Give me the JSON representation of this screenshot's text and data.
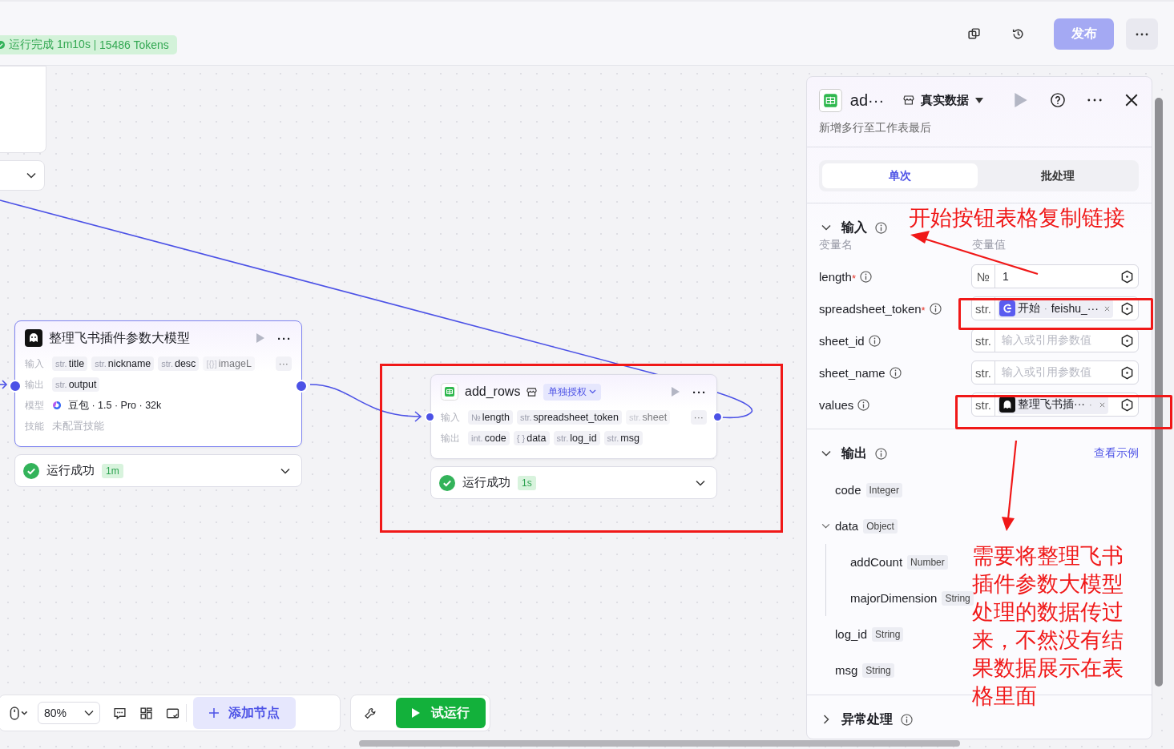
{
  "header": {
    "run_status": "运行完成 1m10s",
    "tokens": "15486 Tokens",
    "publish_button": "发布",
    "publish_disabled": true
  },
  "nodes": [
    {
      "kind": "model",
      "title": "整理飞书插件参数大模型",
      "selected": true,
      "more": "···",
      "rows": [
        {
          "label": "输入",
          "overflow": "···",
          "params": [
            {
              "type": "str.",
              "name": "title",
              "faded": false
            },
            {
              "type": "str.",
              "name": "nickname",
              "faded": false
            },
            {
              "type": "str.",
              "name": "desc",
              "faded": false
            },
            {
              "type": "[{}]",
              "name": "imageL",
              "faded": true
            }
          ]
        },
        {
          "label": "输出",
          "params": [
            {
              "type": "str.",
              "name": "output",
              "faded": false
            }
          ]
        }
      ],
      "info": [
        {
          "label": "模型",
          "value": "豆包 · 1.5 · Pro · 32k",
          "kind": "model"
        },
        {
          "label": "技能",
          "value": "未配置技能",
          "kind": "empty"
        }
      ],
      "status": "运行成功",
      "duration": "1m"
    },
    {
      "kind": "sheet",
      "title": "add_rows",
      "auth_tag": "单独授权",
      "selected": false,
      "more": "···",
      "rows": [
        {
          "label": "输入",
          "overflow": "···",
          "params": [
            {
              "type": "№",
              "name": "length",
              "faded": false
            },
            {
              "type": "str.",
              "name": "spreadsheet_token",
              "faded": false
            },
            {
              "type": "str.",
              "name": "sheet",
              "faded": true
            }
          ]
        },
        {
          "label": "输出",
          "params": [
            {
              "type": "int.",
              "name": "code",
              "faded": false
            },
            {
              "type": "{ }",
              "name": "data",
              "faded": false
            },
            {
              "type": "str.",
              "name": "log_id",
              "faded": false
            },
            {
              "type": "str.",
              "name": "msg",
              "faded": false
            }
          ]
        }
      ],
      "status": "运行成功",
      "duration": "1s"
    }
  ],
  "panel": {
    "title": "ad···",
    "data_mode": "真实数据",
    "subtitle": "新增多行至工作表最后",
    "tabs": [
      {
        "label": "单次",
        "selected": true
      },
      {
        "label": "批处理",
        "selected": false
      }
    ],
    "input": {
      "title": "输入",
      "expanded": true,
      "col_name": "变量名",
      "col_value": "变量值",
      "required_mark": "*",
      "params": [
        {
          "name": "length",
          "required": true,
          "type": "№",
          "kind": "text",
          "value": "1"
        },
        {
          "name": "spreadsheet_token",
          "required": true,
          "type": "str.",
          "kind": "ref",
          "ref": {
            "kind": "start",
            "source": "开始",
            "sep": "·",
            "var": "feishu_···"
          }
        },
        {
          "name": "sheet_id",
          "required": false,
          "type": "str.",
          "kind": "empty",
          "placeholder": "输入或引用参数值"
        },
        {
          "name": "sheet_name",
          "required": false,
          "type": "str.",
          "kind": "empty",
          "placeholder": "输入或引用参数值"
        },
        {
          "name": "values",
          "required": false,
          "type": "str.",
          "kind": "ref",
          "ref": {
            "kind": "model",
            "source": "整理飞书插···",
            "sep": "·"
          }
        }
      ]
    },
    "output": {
      "title": "输出",
      "expanded": true,
      "link": "查看示例",
      "fields": [
        {
          "name": "code",
          "type": "Integer"
        },
        {
          "name": "data",
          "type": "Object",
          "expanded": true,
          "children": [
            {
              "name": "addCount",
              "type": "Number"
            },
            {
              "name": "majorDimension",
              "type": "String"
            }
          ]
        },
        {
          "name": "log_id",
          "type": "String"
        },
        {
          "name": "msg",
          "type": "String"
        }
      ]
    },
    "error_section": {
      "title": "异常处理",
      "expanded": false
    }
  },
  "bottom_toolbar": {
    "zoom": "80%",
    "add_node": "添加节点",
    "test_run": "试运行"
  },
  "annotations": [
    {
      "kind": "top",
      "text": "开始按钮表格复制链接"
    },
    {
      "kind": "bottom",
      "text": "需要将整理飞书插件参数大模型处理的数据传过来，不然没有结果数据展示在表格里面"
    }
  ]
}
